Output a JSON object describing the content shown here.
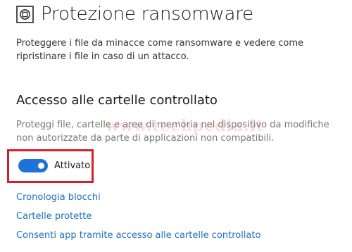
{
  "header": {
    "icon": "ransomware-shield-icon",
    "title": "Protezione ransomware"
  },
  "intro": {
    "text": "Proteggere i file da minacce come ransomware e vedere come ripristinare i file in caso di un attacco."
  },
  "controlled_folder_access": {
    "heading": "Accesso alle cartelle controllato",
    "description": "Proteggi file, cartelle e aree di memoria nel dispositivo da modifiche non autorizzate da parte di applicazioni non compatibili.",
    "toggle": {
      "state": "on",
      "label": "Attivato"
    }
  },
  "links": {
    "block_history": "Cronologia blocchi",
    "protected_folders": "Cartelle protette",
    "allow_app": "Consenti app tramite accesso alle cartelle controllato"
  },
  "watermark": "www.techpedia.it",
  "colors": {
    "accent": "#1e73d8",
    "link": "#1f6dbf",
    "highlight_border": "#d4202a"
  }
}
